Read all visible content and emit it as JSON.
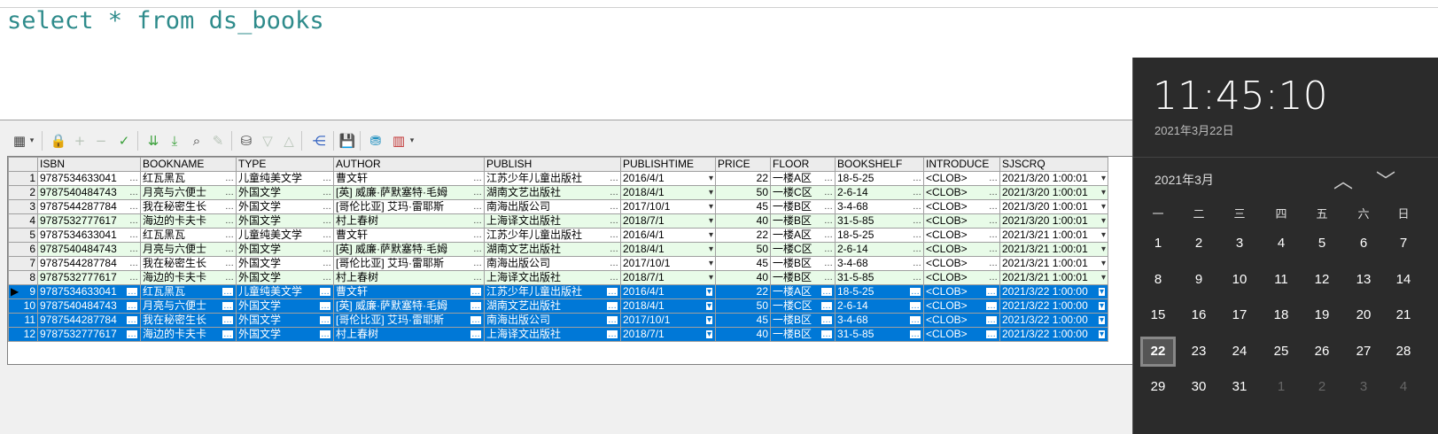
{
  "editor": {
    "sql": "select * from ds_books"
  },
  "grid": {
    "columns": [
      "ISBN",
      "BOOKNAME",
      "TYPE",
      "AUTHOR",
      "PUBLISH",
      "PUBLISHTIME",
      "PRICE",
      "FLOOR",
      "BOOKSHELF",
      "INTRODUCE",
      "SJSCRQ"
    ],
    "rows": [
      {
        "n": "1",
        "isbn": "9787534633041",
        "name": "红瓦黑瓦",
        "type": "儿童纯美文学",
        "author": "曹文轩",
        "publish": "江苏少年儿童出版社",
        "time": "2016/4/1",
        "price": "22",
        "floor": "一楼A区",
        "shelf": "18-5-25",
        "intro": "<CLOB>",
        "date": "2021/3/20 1:00:01"
      },
      {
        "n": "2",
        "isbn": "9787540484743",
        "name": "月亮与六便士",
        "type": "外国文学",
        "author": "[英] 威廉·萨默塞特·毛姆",
        "publish": "湖南文艺出版社",
        "time": "2018/4/1",
        "price": "50",
        "floor": "一楼C区",
        "shelf": "2-6-14",
        "intro": "<CLOB>",
        "date": "2021/3/20 1:00:01"
      },
      {
        "n": "3",
        "isbn": "9787544287784",
        "name": "我在秘密生长",
        "type": "外国文学",
        "author": "[哥伦比亚] 艾玛·雷耶斯",
        "publish": "南海出版公司",
        "time": "2017/10/1",
        "price": "45",
        "floor": "一楼B区",
        "shelf": "3-4-68",
        "intro": "<CLOB>",
        "date": "2021/3/20 1:00:01"
      },
      {
        "n": "4",
        "isbn": "9787532777617",
        "name": "海边的卡夫卡",
        "type": "外国文学",
        "author": "村上春树",
        "publish": "上海译文出版社",
        "time": "2018/7/1",
        "price": "40",
        "floor": "一楼B区",
        "shelf": "31-5-85",
        "intro": "<CLOB>",
        "date": "2021/3/20 1:00:01"
      },
      {
        "n": "5",
        "isbn": "9787534633041",
        "name": "红瓦黑瓦",
        "type": "儿童纯美文学",
        "author": "曹文轩",
        "publish": "江苏少年儿童出版社",
        "time": "2016/4/1",
        "price": "22",
        "floor": "一楼A区",
        "shelf": "18-5-25",
        "intro": "<CLOB>",
        "date": "2021/3/21 1:00:01"
      },
      {
        "n": "6",
        "isbn": "9787540484743",
        "name": "月亮与六便士",
        "type": "外国文学",
        "author": "[英] 威廉·萨默塞特·毛姆",
        "publish": "湖南文艺出版社",
        "time": "2018/4/1",
        "price": "50",
        "floor": "一楼C区",
        "shelf": "2-6-14",
        "intro": "<CLOB>",
        "date": "2021/3/21 1:00:01"
      },
      {
        "n": "7",
        "isbn": "9787544287784",
        "name": "我在秘密生长",
        "type": "外国文学",
        "author": "[哥伦比亚] 艾玛·雷耶斯",
        "publish": "南海出版公司",
        "time": "2017/10/1",
        "price": "45",
        "floor": "一楼B区",
        "shelf": "3-4-68",
        "intro": "<CLOB>",
        "date": "2021/3/21 1:00:01"
      },
      {
        "n": "8",
        "isbn": "9787532777617",
        "name": "海边的卡夫卡",
        "type": "外国文学",
        "author": "村上春树",
        "publish": "上海译文出版社",
        "time": "2018/7/1",
        "price": "40",
        "floor": "一楼B区",
        "shelf": "31-5-85",
        "intro": "<CLOB>",
        "date": "2021/3/21 1:00:01"
      },
      {
        "n": "9",
        "isbn": "9787534633041",
        "name": "红瓦黑瓦",
        "type": "儿童纯美文学",
        "author": "曹文轩",
        "publish": "江苏少年儿童出版社",
        "time": "2016/4/1",
        "price": "22",
        "floor": "一楼A区",
        "shelf": "18-5-25",
        "intro": "<CLOB>",
        "date": "2021/3/22 1:00:00",
        "selected": true
      },
      {
        "n": "10",
        "isbn": "9787540484743",
        "name": "月亮与六便士",
        "type": "外国文学",
        "author": "[英] 威廉·萨默塞特·毛姆",
        "publish": "湖南文艺出版社",
        "time": "2018/4/1",
        "price": "50",
        "floor": "一楼C区",
        "shelf": "2-6-14",
        "intro": "<CLOB>",
        "date": "2021/3/22 1:00:00",
        "selected": true
      },
      {
        "n": "11",
        "isbn": "9787544287784",
        "name": "我在秘密生长",
        "type": "外国文学",
        "author": "[哥伦比亚] 艾玛·雷耶斯",
        "publish": "南海出版公司",
        "time": "2017/10/1",
        "price": "45",
        "floor": "一楼B区",
        "shelf": "3-4-68",
        "intro": "<CLOB>",
        "date": "2021/3/22 1:00:00",
        "selected": true
      },
      {
        "n": "12",
        "isbn": "9787532777617",
        "name": "海边的卡夫卡",
        "type": "外国文学",
        "author": "村上春树",
        "publish": "上海译文出版社",
        "time": "2018/7/1",
        "price": "40",
        "floor": "一楼B区",
        "shelf": "31-5-85",
        "intro": "<CLOB>",
        "date": "2021/3/22 1:00:00",
        "selected": true
      }
    ]
  },
  "calendar": {
    "time": "11:45:10",
    "date_long": "2021年3月22日",
    "month": "2021年3月",
    "weekdays": [
      "一",
      "二",
      "三",
      "四",
      "五",
      "六",
      "日"
    ],
    "weeks": [
      [
        "1",
        "2",
        "3",
        "4",
        "5",
        "6",
        "7"
      ],
      [
        "8",
        "9",
        "10",
        "11",
        "12",
        "13",
        "14"
      ],
      [
        "15",
        "16",
        "17",
        "18",
        "19",
        "20",
        "21"
      ],
      [
        "22",
        "23",
        "24",
        "25",
        "26",
        "27",
        "28"
      ],
      [
        "29",
        "30",
        "31",
        "1",
        "2",
        "3",
        "4"
      ]
    ],
    "today": "22",
    "colors": {
      "selection": "#0078d7",
      "alt_row": "#e8fbe8",
      "sql_text": "#2e8b8b"
    }
  }
}
